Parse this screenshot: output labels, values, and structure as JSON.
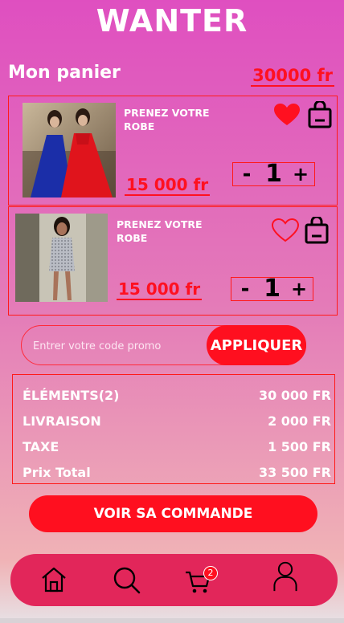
{
  "app": {
    "brand": "WANTER"
  },
  "cart": {
    "title": "Mon panier",
    "total": "30000 fr"
  },
  "items": [
    {
      "name": "PRENEZ VOTRE ROBE",
      "price": "15 000 fr",
      "quantity": "1",
      "favorite": true,
      "image": "two-women-in-blue-and-red-gowns"
    },
    {
      "name": "PRENEZ VOTRE ROBE",
      "price": "15 000 fr",
      "quantity": "1",
      "favorite": false,
      "image": "woman-in-silver-sequin-dress"
    }
  ],
  "qty_controls": {
    "minus": "-",
    "plus": "+"
  },
  "promo": {
    "placeholder": "Entrer votre code promo",
    "button": "APPLIQUER"
  },
  "summary": [
    {
      "label": "ÉLÉMENTS(2)",
      "value": "30 000 FR"
    },
    {
      "label": "LIVRAISON",
      "value": "2 000 FR"
    },
    {
      "label": "TAXE",
      "value": "1 500 FR"
    },
    {
      "label": "Prix Total",
      "value": "33 500 FR"
    }
  ],
  "order_button": "VOIR SA COMMANDE",
  "nav": {
    "items": [
      "home-icon",
      "search-icon",
      "cart-icon",
      "profile-icon"
    ],
    "cart_badge": "2"
  },
  "colors": {
    "accent": "#ff0f1f",
    "navbar": "#e2265a"
  }
}
